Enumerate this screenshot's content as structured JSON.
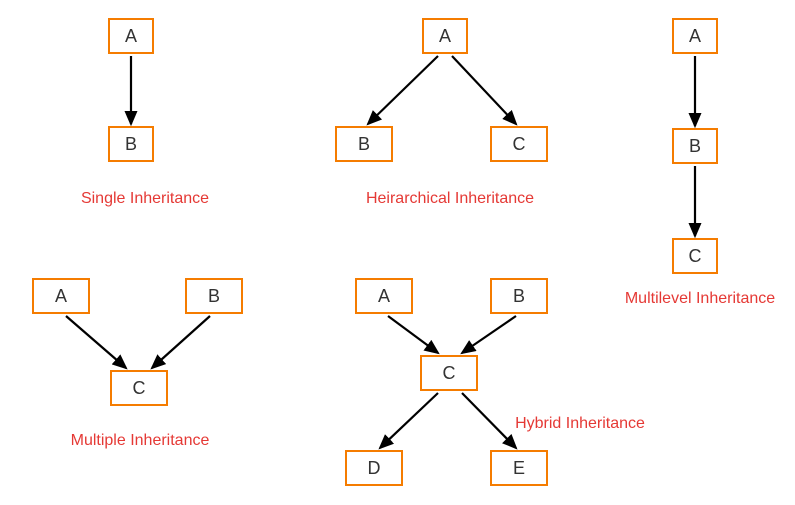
{
  "diagrams": {
    "single": {
      "title": "Single Inheritance",
      "nodes": {
        "a": "A",
        "b": "B"
      }
    },
    "hierarchical": {
      "title": "Heirarchical Inheritance",
      "nodes": {
        "a": "A",
        "b": "B",
        "c": "C"
      }
    },
    "multilevel": {
      "title": "Multilevel Inheritance",
      "nodes": {
        "a": "A",
        "b": "B",
        "c": "C"
      }
    },
    "multiple": {
      "title": "Multiple Inheritance",
      "nodes": {
        "a": "A",
        "b": "B",
        "c": "C"
      }
    },
    "hybrid": {
      "title": "Hybrid Inheritance",
      "nodes": {
        "a": "A",
        "b": "B",
        "c": "C",
        "d": "D",
        "e": "E"
      }
    }
  },
  "chart_data": [
    {
      "type": "diagram",
      "title": "Single Inheritance",
      "nodes": [
        "A",
        "B"
      ],
      "edges": [
        [
          "A",
          "B"
        ]
      ]
    },
    {
      "type": "diagram",
      "title": "Heirarchical Inheritance",
      "nodes": [
        "A",
        "B",
        "C"
      ],
      "edges": [
        [
          "A",
          "B"
        ],
        [
          "A",
          "C"
        ]
      ]
    },
    {
      "type": "diagram",
      "title": "Multilevel Inheritance",
      "nodes": [
        "A",
        "B",
        "C"
      ],
      "edges": [
        [
          "A",
          "B"
        ],
        [
          "B",
          "C"
        ]
      ]
    },
    {
      "type": "diagram",
      "title": "Multiple Inheritance",
      "nodes": [
        "A",
        "B",
        "C"
      ],
      "edges": [
        [
          "A",
          "C"
        ],
        [
          "B",
          "C"
        ]
      ]
    },
    {
      "type": "diagram",
      "title": "Hybrid Inheritance",
      "nodes": [
        "A",
        "B",
        "C",
        "D",
        "E"
      ],
      "edges": [
        [
          "A",
          "C"
        ],
        [
          "B",
          "C"
        ],
        [
          "C",
          "D"
        ],
        [
          "C",
          "E"
        ]
      ]
    }
  ]
}
